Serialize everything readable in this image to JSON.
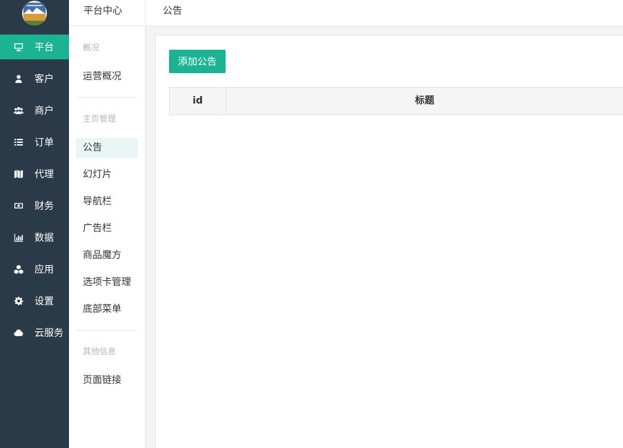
{
  "nav": {
    "items": [
      {
        "label": "平台",
        "icon": "monitor-icon"
      },
      {
        "label": "客户",
        "icon": "user-icon"
      },
      {
        "label": "商户",
        "icon": "users-icon"
      },
      {
        "label": "订单",
        "icon": "list-icon"
      },
      {
        "label": "代理",
        "icon": "map-icon"
      },
      {
        "label": "财务",
        "icon": "money-icon"
      },
      {
        "label": "数据",
        "icon": "bar-chart-icon"
      },
      {
        "label": "应用",
        "icon": "cubes-icon"
      },
      {
        "label": "设置",
        "icon": "gear-icon"
      },
      {
        "label": "云服务",
        "icon": "cloud-icon"
      }
    ],
    "active_index": 0
  },
  "subnav": {
    "title": "平台中心",
    "groups": [
      {
        "title": "概况",
        "items": [
          "运营概况"
        ]
      },
      {
        "title": "主页管理",
        "items": [
          "公告",
          "幻灯片",
          "导航栏",
          "广告栏",
          "商品魔方",
          "选项卡管理",
          "底部菜单"
        ]
      },
      {
        "title": "其他信息",
        "items": [
          "页面链接"
        ]
      }
    ],
    "active_item": "公告"
  },
  "topbar": {
    "breadcrumb": "公告"
  },
  "main": {
    "add_button": "添加公告",
    "table": {
      "columns": [
        "id",
        "标题"
      ],
      "rows": []
    }
  },
  "colors": {
    "accent": "#1bb394",
    "sidebar_bg": "#2b3a48",
    "active_sub_bg": "#e8f7f3"
  }
}
